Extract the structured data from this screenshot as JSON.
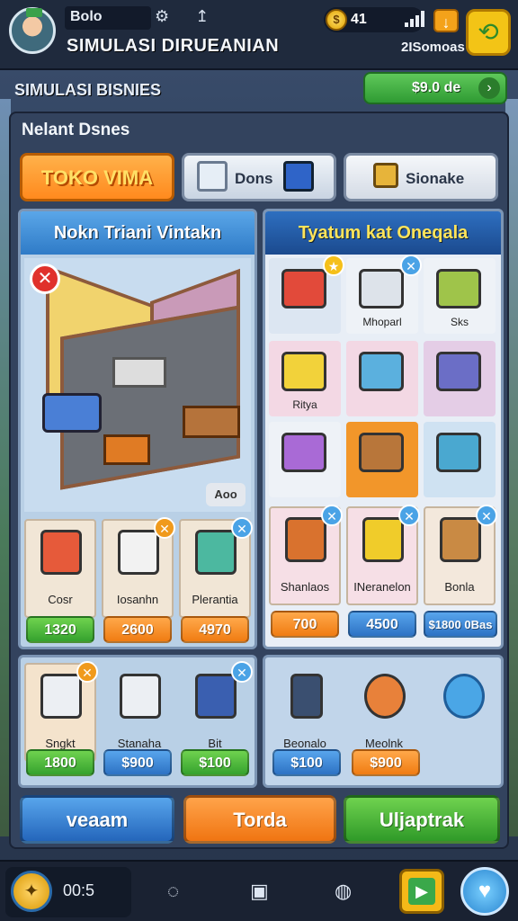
{
  "header": {
    "player_name": "Bolo",
    "game_title": "SIMULASI DIRUEANIAN",
    "coins": "41",
    "sub_status": "2ISomoas",
    "sim_label": "SIMULASI BISNIES",
    "money_button": "$9.0 de"
  },
  "main": {
    "title": "Nelant Dsnes",
    "tabs": [
      {
        "label": "TOKO VIMA"
      },
      {
        "label": "Dons"
      },
      {
        "label": "Sionake"
      }
    ],
    "left_panel_title": "Nokn Triani Vintakn",
    "right_panel_title": "Tyatum kat Oneqala",
    "room_chip": "Aoo",
    "left_items": [
      {
        "name": "Cosr",
        "price": "1320"
      },
      {
        "name": "Iosanhn",
        "price": "2600"
      },
      {
        "name": "Plerantia",
        "price": "4970"
      }
    ],
    "right_grid": [
      {
        "name": ""
      },
      {
        "name": "Mhoparl"
      },
      {
        "name": "Sks"
      },
      {
        "name": "Ritya"
      },
      {
        "name": ""
      },
      {
        "name": ""
      },
      {
        "name": ""
      },
      {
        "name": ""
      },
      {
        "name": ""
      }
    ],
    "right_items": [
      {
        "name": "Shanlaos",
        "price": "700"
      },
      {
        "name": "INeranelon",
        "price": "4500"
      },
      {
        "name": "Bonla",
        "price": "$1800 0Bas"
      }
    ],
    "bottom_left_items": [
      {
        "name": "Sngkt",
        "price": "1800"
      },
      {
        "name": "Stanaha",
        "price": "$900"
      },
      {
        "name": "Bit",
        "price": "$100"
      }
    ],
    "bottom_right_items": [
      {
        "name": "Beonalo",
        "price": "$100"
      },
      {
        "name": "Meolnk",
        "price": "$900"
      }
    ]
  },
  "actions": {
    "a1": "veaam",
    "a2": "Torda",
    "a3": "Uljaptrak"
  },
  "bottombar": {
    "time": "00:5"
  },
  "colors": {
    "green": "#35a22e",
    "orange": "#f07c12",
    "blue": "#2d72c4",
    "panel": "#33435e"
  }
}
